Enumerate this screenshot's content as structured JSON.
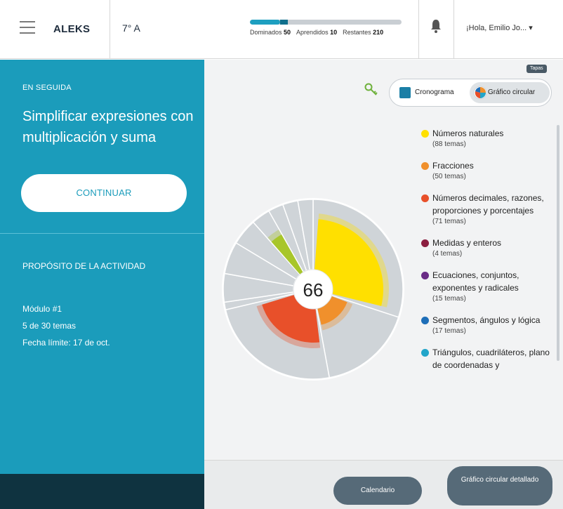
{
  "header": {
    "logo": "ALEKS",
    "class_name": "7° A",
    "progress": {
      "mastered_fraction": 0.2,
      "learned_fraction": 0.05,
      "stats": [
        {
          "label": "Dominados",
          "value": "50"
        },
        {
          "label": "Aprendidos",
          "value": "10"
        },
        {
          "label": "Restantes",
          "value": "210"
        }
      ]
    },
    "bell_icon": "bell-icon",
    "greeting": "¡Hola, Emilio Jo... ▾"
  },
  "left_panel": {
    "next_label": "EN SEGUIDA",
    "topic_title": "Simplificar expresiones con multiplicación y suma",
    "continue_label": "CONTINUAR",
    "purpose_label": "PROPÓSITO DE LA ACTIVIDAD",
    "module": "Módulo #1",
    "topics_progress": "5 de 30 temas",
    "due_date": "Fecha límite: 17 de oct."
  },
  "view_toggle": {
    "badge": "Tapas",
    "options": [
      "Cronograma",
      "Gráfico circular"
    ],
    "selected": "Gráfico circular"
  },
  "chart_data": {
    "type": "pie",
    "center_value": "66",
    "slice_colors": [
      "#ffe000",
      "#f0902c",
      "#e8502a",
      "#8b1e3f",
      "#6a2c86",
      "#1e6eb8",
      "#22a5c9",
      "#a8c62a"
    ],
    "segments": [
      {
        "category": "Números naturales",
        "total": 88,
        "completed_fraction": 0.72
      },
      {
        "category": "Fracciones",
        "total": 50,
        "completed_fraction": 0.24
      },
      {
        "category": "Números decimales, razones, proporciones y porcentajes",
        "total": 71,
        "completed_fraction": 0.48
      },
      {
        "category": "Medidas y enteros",
        "total": 4,
        "completed_fraction": 0
      },
      {
        "category": "Ecuaciones, conjuntos, exponentes y radicales",
        "total": 15,
        "completed_fraction": 0
      },
      {
        "category": "Segmentos, ángulos y lógica",
        "total": 17,
        "completed_fraction": 0
      },
      {
        "category": "Triángulos, cuadriláteros, plano de coordenadas y",
        "total": 14,
        "completed_fraction": 0
      },
      {
        "category": "",
        "total": 10,
        "completed_fraction": 0.62
      },
      {
        "category": "",
        "total": 8,
        "completed_fraction": 0
      },
      {
        "category": "",
        "total": 8,
        "completed_fraction": 0
      },
      {
        "category": "",
        "total": 8,
        "completed_fraction": 0
      }
    ]
  },
  "legend": [
    {
      "name": "Números naturales",
      "count": "(88 temas)",
      "color": "#ffe000"
    },
    {
      "name": "Fracciones",
      "count": "(50 temas)",
      "color": "#f0902c"
    },
    {
      "name": "Números decimales, razones, proporciones y porcentajes",
      "count": "(71 temas)",
      "color": "#e8502a"
    },
    {
      "name": "Medidas y enteros",
      "count": "(4 temas)",
      "color": "#8b1e3f"
    },
    {
      "name": "Ecuaciones, conjuntos, exponentes y radicales",
      "count": "(15 temas)",
      "color": "#6a2c86"
    },
    {
      "name": "Segmentos, ángulos y lógica",
      "count": "(17 temas)",
      "color": "#1e6eb8"
    },
    {
      "name": "Triángulos, cuadriláteros, plano de coordenadas y",
      "count": "",
      "color": "#22a5c9"
    }
  ],
  "footer": {
    "calendar_label": "Calendario",
    "detail_label": "Gráfico circular detallado"
  }
}
